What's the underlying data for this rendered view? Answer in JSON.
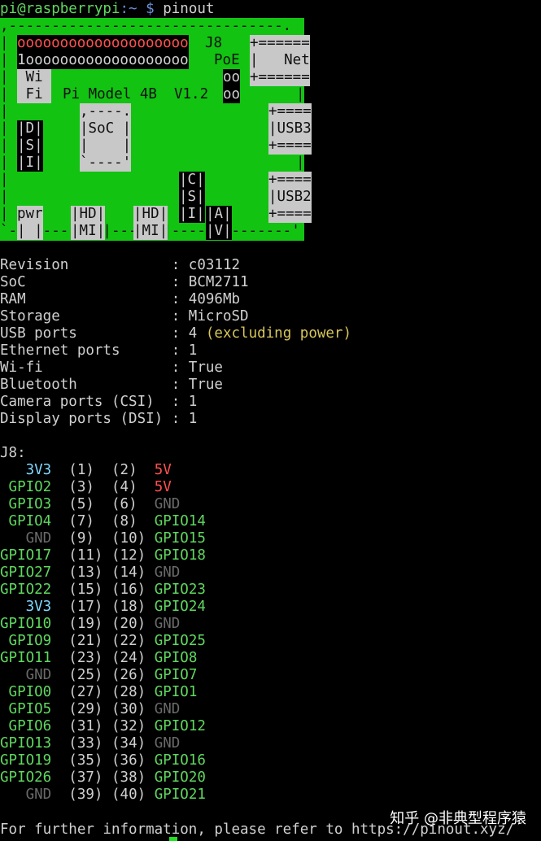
{
  "prompt": {
    "user_host": "pi@raspberrypi",
    "path": ":~",
    "symbol": " $",
    "command": " pinout"
  },
  "board": {
    "border_top": ",--------------------------------.",
    "pins_row1": "oooooooooooooooooooo",
    "pins_row2": "1ooooooooooooooooooo",
    "j8": "J8",
    "poe": "PoE",
    "net_top": "+======",
    "net_mid": "|   Net",
    "net_bot": "+======",
    "wifi1": " Wi ",
    "wifi2": " Fi ",
    "model": "Pi Model 4B  V1.2",
    "oo1": "oo",
    "oo2": "oo",
    "soc1": ",----.",
    "soc2": "|SoC |",
    "soc3": "|    |",
    "soc4": "`----'",
    "dsi1": "|D|",
    "dsi2": "|S|",
    "dsi3": "|I|",
    "usb3_top": "+====",
    "usb3_mid": "|USB3",
    "usb3_bot": "+====",
    "csi1": "|C|",
    "csi2": "|S|",
    "csi3": "|I|",
    "av1": "|A|",
    "av2": "|V|",
    "usb2_top": "+====",
    "usb2_mid": "|USB2",
    "usb2_bot": "+====",
    "pwr1": "pwr",
    "pwr2": "| |",
    "hd1a": "|HD|",
    "hd1b": "|MI|",
    "hd2a": "|HD|",
    "hd2b": "|MI|",
    "border_bot": "`-| |----|MI|---|MI|----|V|-------'"
  },
  "info": [
    {
      "key": "Revision           ",
      "value": ": c03112",
      "note": ""
    },
    {
      "key": "SoC                ",
      "value": ": BCM2711",
      "note": ""
    },
    {
      "key": "RAM                ",
      "value": ": 4096Mb",
      "note": ""
    },
    {
      "key": "Storage            ",
      "value": ": MicroSD",
      "note": ""
    },
    {
      "key": "USB ports          ",
      "value": ": 4 ",
      "note": "(excluding power)"
    },
    {
      "key": "Ethernet ports     ",
      "value": ": 1",
      "note": ""
    },
    {
      "key": "Wi-fi              ",
      "value": ": True",
      "note": ""
    },
    {
      "key": "Bluetooth          ",
      "value": ": True",
      "note": ""
    },
    {
      "key": "Camera ports (CSI) ",
      "value": ": 1",
      "note": ""
    },
    {
      "key": "Display ports (DSI)",
      "value": ": 1",
      "note": ""
    }
  ],
  "header_label": "J8:",
  "pins": [
    {
      "l": "   3V3",
      "lc": "c-blue",
      "a": "(1) ",
      "b": "(2) ",
      "r": "5V",
      "rc": "c-red"
    },
    {
      "l": " GPIO2",
      "lc": "c-green",
      "a": "(3) ",
      "b": "(4) ",
      "r": "5V",
      "rc": "c-red"
    },
    {
      "l": " GPIO3",
      "lc": "c-green",
      "a": "(5) ",
      "b": "(6) ",
      "r": "GND",
      "rc": "c-gnd"
    },
    {
      "l": " GPIO4",
      "lc": "c-green",
      "a": "(7) ",
      "b": "(8) ",
      "r": "GPIO14",
      "rc": "c-green"
    },
    {
      "l": "   GND",
      "lc": "c-gnd",
      "a": "(9) ",
      "b": "(10)",
      "r": "GPIO15",
      "rc": "c-green"
    },
    {
      "l": "GPIO17",
      "lc": "c-green",
      "a": "(11)",
      "b": "(12)",
      "r": "GPIO18",
      "rc": "c-green"
    },
    {
      "l": "GPIO27",
      "lc": "c-green",
      "a": "(13)",
      "b": "(14)",
      "r": "GND",
      "rc": "c-gnd"
    },
    {
      "l": "GPIO22",
      "lc": "c-green",
      "a": "(15)",
      "b": "(16)",
      "r": "GPIO23",
      "rc": "c-green"
    },
    {
      "l": "   3V3",
      "lc": "c-blue",
      "a": "(17)",
      "b": "(18)",
      "r": "GPIO24",
      "rc": "c-green"
    },
    {
      "l": "GPIO10",
      "lc": "c-green",
      "a": "(19)",
      "b": "(20)",
      "r": "GND",
      "rc": "c-gnd"
    },
    {
      "l": " GPIO9",
      "lc": "c-green",
      "a": "(21)",
      "b": "(22)",
      "r": "GPIO25",
      "rc": "c-green"
    },
    {
      "l": "GPIO11",
      "lc": "c-green",
      "a": "(23)",
      "b": "(24)",
      "r": "GPIO8",
      "rc": "c-green"
    },
    {
      "l": "   GND",
      "lc": "c-gnd",
      "a": "(25)",
      "b": "(26)",
      "r": "GPIO7",
      "rc": "c-green"
    },
    {
      "l": " GPIO0",
      "lc": "c-green",
      "a": "(27)",
      "b": "(28)",
      "r": "GPIO1",
      "rc": "c-green"
    },
    {
      "l": " GPIO5",
      "lc": "c-green",
      "a": "(29)",
      "b": "(30)",
      "r": "GND",
      "rc": "c-gnd"
    },
    {
      "l": " GPIO6",
      "lc": "c-green",
      "a": "(31)",
      "b": "(32)",
      "r": "GPIO12",
      "rc": "c-green"
    },
    {
      "l": "GPIO13",
      "lc": "c-green",
      "a": "(33)",
      "b": "(34)",
      "r": "GND",
      "rc": "c-gnd"
    },
    {
      "l": "GPIO19",
      "lc": "c-green",
      "a": "(35)",
      "b": "(36)",
      "r": "GPIO16",
      "rc": "c-green"
    },
    {
      "l": "GPIO26",
      "lc": "c-green",
      "a": "(37)",
      "b": "(38)",
      "r": "GPIO20",
      "rc": "c-green"
    },
    {
      "l": "   GND",
      "lc": "c-gnd",
      "a": "(39)",
      "b": "(40)",
      "r": "GPIO21",
      "rc": "c-green"
    }
  ],
  "footer": "For further information, please refer to https://pinout.xyz/",
  "watermark": "知乎 @非典型程序猿"
}
